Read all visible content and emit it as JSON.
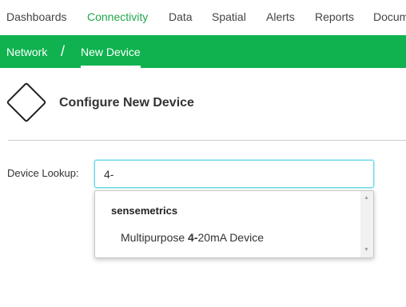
{
  "topnav": {
    "items": [
      {
        "label": "Dashboards",
        "active": false
      },
      {
        "label": "Connectivity",
        "active": true
      },
      {
        "label": "Data",
        "active": false
      },
      {
        "label": "Spatial",
        "active": false
      },
      {
        "label": "Alerts",
        "active": false
      },
      {
        "label": "Reports",
        "active": false
      },
      {
        "label": "Docum",
        "active": false
      }
    ]
  },
  "breadcrumb": {
    "parent": "Network",
    "separator": "/",
    "current": "New Device"
  },
  "header": {
    "icon": "diamond-icon",
    "title": "Configure New Device"
  },
  "form": {
    "lookup_label": "Device Lookup:",
    "lookup_value": "4-"
  },
  "dropdown": {
    "group_label": "sensemetrics",
    "options": [
      {
        "prefix": "Multipurpose ",
        "match": "4-",
        "suffix": "20mA Device"
      }
    ],
    "scroll_up_icon": "▲",
    "scroll_down_icon": "▼"
  },
  "colors": {
    "brand_green": "#0fb24f",
    "active_nav": "#1fa64b",
    "focus_border": "#66d9e8"
  }
}
